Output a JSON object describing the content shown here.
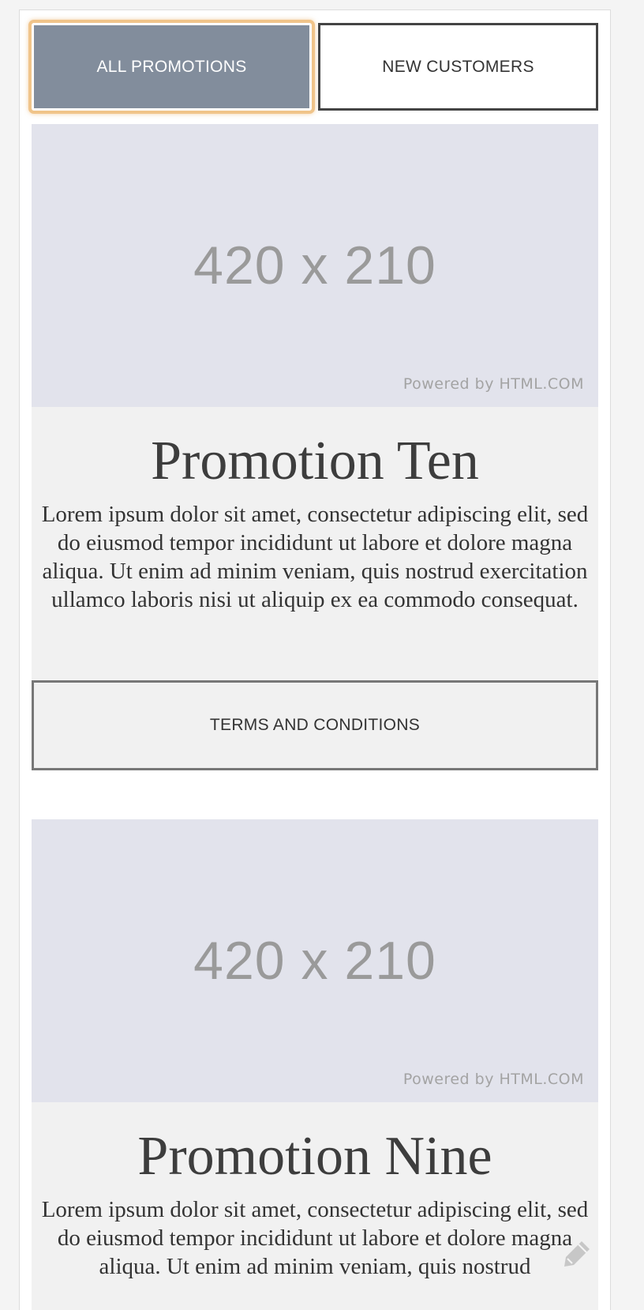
{
  "tabs": {
    "all_promotions": "ALL PROMOTIONS",
    "new_customers": "NEW CUSTOMERS"
  },
  "promotions": [
    {
      "image_label": "420 x 210",
      "image_credit": "Powered by HTML.COM",
      "title": "Promotion Ten",
      "body": "Lorem ipsum dolor sit amet, consectetur adipiscing elit, sed do eiusmod tempor incididunt ut labore et dolore magna aliqua. Ut enim ad minim veniam, quis nostrud exercitation ullamco laboris nisi ut aliquip ex ea commodo consequat.",
      "terms_label": "TERMS AND CONDITIONS"
    },
    {
      "image_label": "420 x 210",
      "image_credit": "Powered by HTML.COM",
      "title": "Promotion Nine",
      "body": "Lorem ipsum dolor sit amet, consectetur adipiscing elit, sed do eiusmod tempor incididunt ut labore et dolore magna aliqua. Ut enim ad minim veniam, quis nostrud"
    }
  ],
  "icons": {
    "floating": "edit-icon"
  },
  "colors": {
    "active_tab_bg": "#828d9c",
    "focus_ring": "#f0c48a",
    "placeholder_bg": "#e2e3ec",
    "card_bg": "#f1f1f1"
  }
}
